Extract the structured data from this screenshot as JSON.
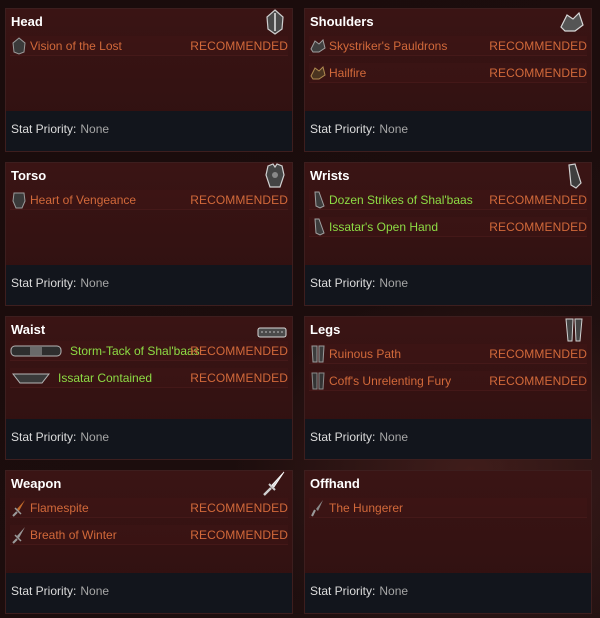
{
  "footer_label": "Stat Priority:",
  "panels": {
    "head": {
      "title": "Head",
      "items": [
        {
          "name": "Vision of the Lost",
          "tag": "RECOMMENDED"
        }
      ],
      "stat_priority": "None"
    },
    "shoulders": {
      "title": "Shoulders",
      "items": [
        {
          "name": "Skystriker's Pauldrons",
          "tag": "RECOMMENDED"
        },
        {
          "name": "Hailfire",
          "tag": "RECOMMENDED"
        }
      ],
      "stat_priority": "None"
    },
    "torso": {
      "title": "Torso",
      "items": [
        {
          "name": "Heart of Vengeance",
          "tag": "RECOMMENDED"
        }
      ],
      "stat_priority": "None"
    },
    "wrists": {
      "title": "Wrists",
      "items": [
        {
          "name": "Dozen Strikes of Shal'baas",
          "tag": "RECOMMENDED"
        },
        {
          "name": "Issatar's Open Hand",
          "tag": "RECOMMENDED"
        }
      ],
      "stat_priority": "None"
    },
    "waist": {
      "title": "Waist",
      "items": [
        {
          "name": "Storm-Tack of Shal'baas",
          "tag": "RECOMMENDED"
        },
        {
          "name": "Issatar Contained",
          "tag": "RECOMMENDED"
        }
      ],
      "stat_priority": "None"
    },
    "legs": {
      "title": "Legs",
      "items": [
        {
          "name": "Ruinous Path",
          "tag": "RECOMMENDED"
        },
        {
          "name": "Coff's Unrelenting Fury",
          "tag": "RECOMMENDED"
        }
      ],
      "stat_priority": "None"
    },
    "weapon": {
      "title": "Weapon",
      "items": [
        {
          "name": "Flamespite",
          "tag": "RECOMMENDED"
        },
        {
          "name": "Breath of Winter",
          "tag": "RECOMMENDED"
        }
      ],
      "stat_priority": "None"
    },
    "offhand": {
      "title": "Offhand",
      "items": [
        {
          "name": "The Hungerer"
        }
      ],
      "stat_priority": "None"
    }
  },
  "icons": {
    "head": "helmet-icon",
    "shoulders": "pauldron-icon",
    "torso": "chest-armor-icon",
    "wrists": "bracer-icon",
    "waist": "belt-icon",
    "legs": "greaves-icon",
    "weapon": "dagger-icon",
    "offhand": "offhand-icon"
  },
  "colors": {
    "item_orange": "#d2693a",
    "item_set_green": "#8ddb44",
    "panel_red": "#3a1414",
    "footer_navy": "#12151c"
  }
}
